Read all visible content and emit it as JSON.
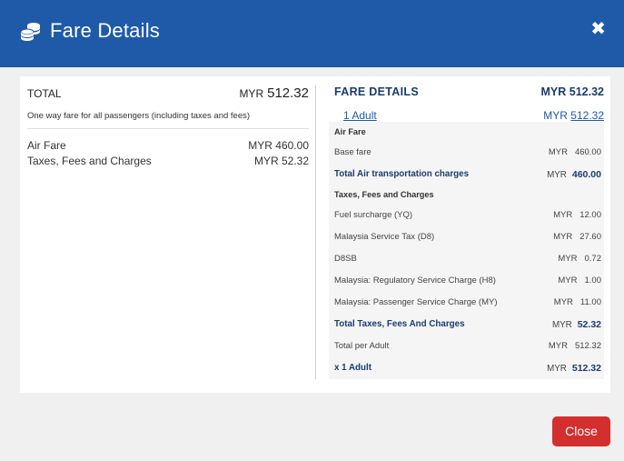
{
  "header": {
    "title": "Fare Details",
    "close_symbol": "✖",
    "icon": "coins-icon",
    "bg_color": "#1e5aa8"
  },
  "left": {
    "total_label": "TOTAL",
    "total_currency": "MYR",
    "total_amount": "512.32",
    "note": "One way fare for all passengers (including taxes and fees)",
    "rows": [
      {
        "label": "Air Fare",
        "value": "MYR 460.00"
      },
      {
        "label": "Taxes, Fees and Charges",
        "value": "MYR 52.32"
      }
    ]
  },
  "right": {
    "title": "FARE DETAILS",
    "total": "MYR 512.32",
    "adult_link": "1 Adult",
    "adult_currency": "MYR",
    "adult_amount": "512.32",
    "air_fare_heading": "Air Fare",
    "base_fare": {
      "label": "Base fare",
      "currency": "MYR",
      "amount": "460.00"
    },
    "total_air": {
      "label": "Total Air transportation charges",
      "currency": "MYR",
      "amount": "460.00"
    },
    "taxes_heading": "Taxes, Fees and Charges",
    "taxes": [
      {
        "label": "Fuel surcharge (YQ)",
        "currency": "MYR",
        "amount": "12.00"
      },
      {
        "label": "Malaysia Service Tax (D8)",
        "currency": "MYR",
        "amount": "27.60"
      },
      {
        "label": "D8SB",
        "currency": "MYR",
        "amount": "0.72"
      },
      {
        "label": "Malaysia: Regulatory Service Charge (H8)",
        "currency": "MYR",
        "amount": "1.00"
      },
      {
        "label": "Malaysia: Passenger Service Charge (MY)",
        "currency": "MYR",
        "amount": "11.00"
      }
    ],
    "total_taxes": {
      "label": "Total Taxes, Fees And Charges",
      "currency": "MYR",
      "amount": "52.32"
    },
    "total_per_adult": {
      "label": "Total per Adult",
      "currency": "MYR",
      "amount": "512.32"
    },
    "x_adult": {
      "label": "x 1 Adult",
      "currency": "MYR",
      "amount": "512.32"
    }
  },
  "footer": {
    "close_label": "Close",
    "close_color": "#d32f2f"
  }
}
